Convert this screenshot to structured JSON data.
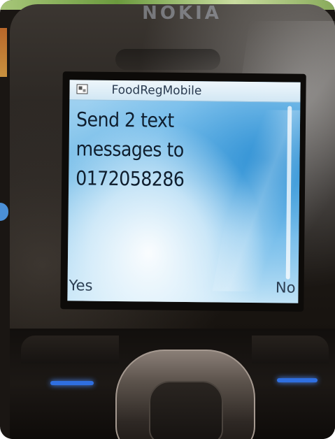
{
  "device": {
    "brand": "NOKIA"
  },
  "screen": {
    "app_title": "FoodRegMobile",
    "app_icon": "app-icon",
    "message_lines": [
      "Send 2 text",
      "messages to",
      "0172058286"
    ],
    "softkeys": {
      "left": "Yes",
      "right": "No"
    }
  },
  "colors": {
    "screen_blue": "#74bce8",
    "keypad_light": "#2f6fe0"
  }
}
